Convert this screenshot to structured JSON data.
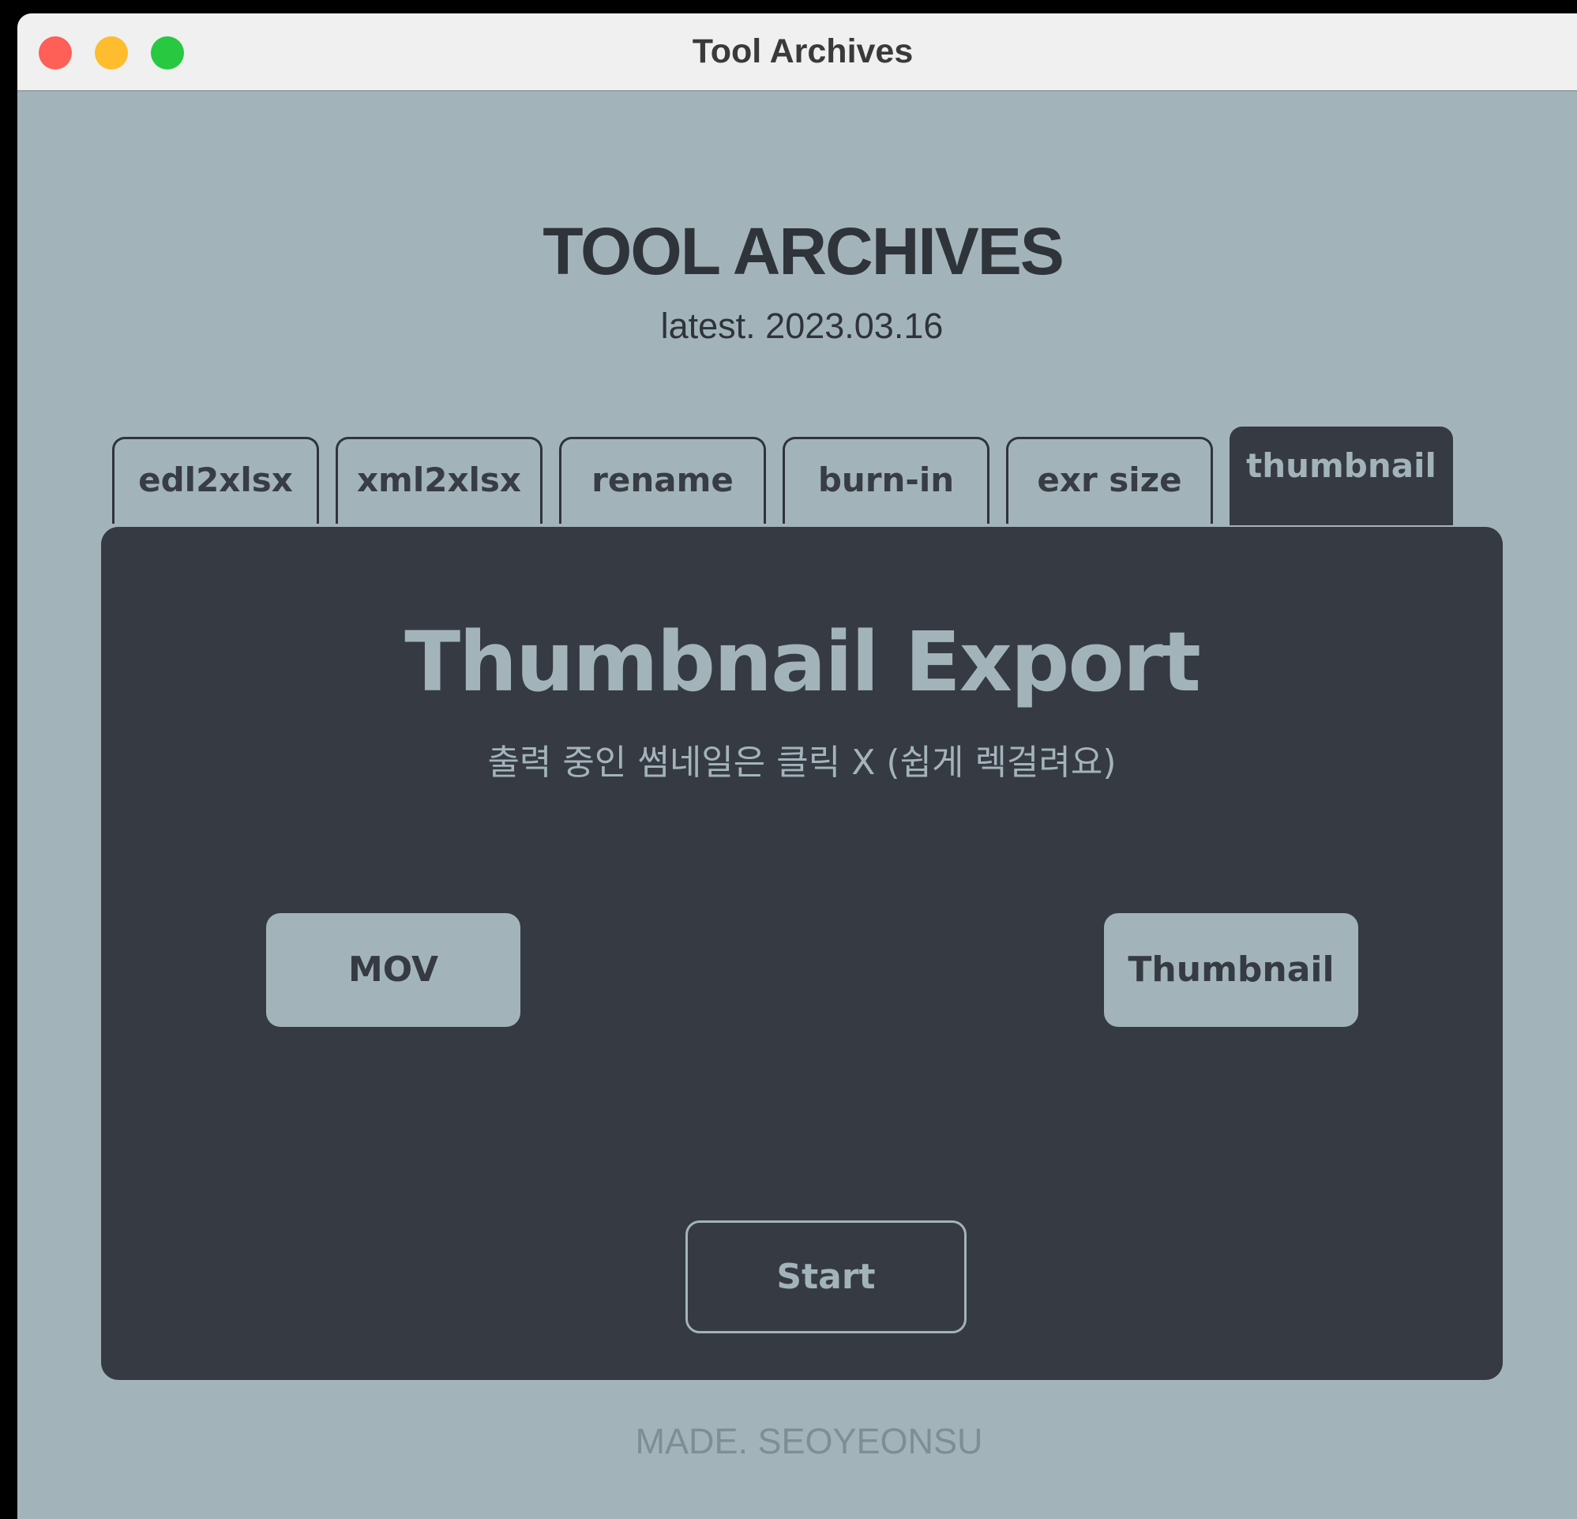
{
  "window": {
    "title": "Tool Archives",
    "controls": [
      "close",
      "minimize",
      "zoom"
    ]
  },
  "header": {
    "title": "TOOL ARCHIVES",
    "subtitle": "latest. 2023.03.16"
  },
  "tabs": [
    {
      "label": "edl2xlsx",
      "active": false
    },
    {
      "label": "xml2xlsx",
      "active": false
    },
    {
      "label": "rename",
      "active": false
    },
    {
      "label": "burn-in",
      "active": false
    },
    {
      "label": "exr size",
      "active": false
    },
    {
      "label": "thumbnail",
      "active": true
    }
  ],
  "panel": {
    "title": "Thumbnail Export",
    "subtitle": "출력 중인 썸네일은 클릭 X (쉽게 렉걸려요)",
    "mov_button": "MOV",
    "thumbnail_button": "Thumbnail",
    "start_button": "Start"
  },
  "footer": {
    "text": "MADE. SEOYEONSU"
  },
  "colors": {
    "background": "#a2b4ba",
    "panel": "#363a43",
    "text_dark": "#2f333a",
    "footer_text": "#7e8e95"
  }
}
